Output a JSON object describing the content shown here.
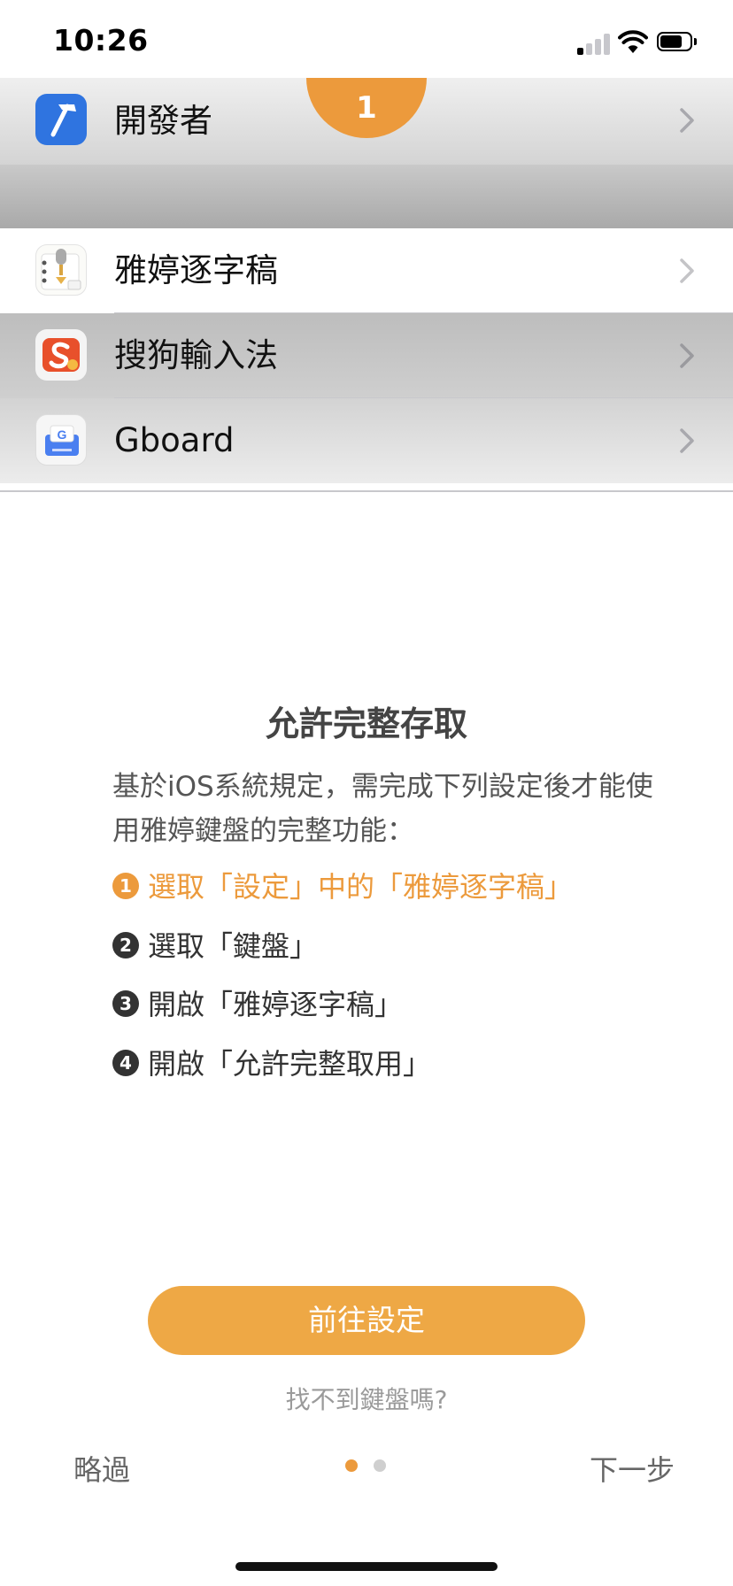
{
  "status_bar": {
    "time": "10:26",
    "signal_bars": 1,
    "wifi_icon": "wifi-icon",
    "battery_level": 0.6
  },
  "settings_preview": {
    "badge": "1",
    "rows": [
      {
        "label": "開發者",
        "icon": "hammer-icon",
        "icon_color": "#2f74e0"
      },
      {
        "label": "雅婷逐字稿",
        "icon": "notepad-microphone-icon"
      },
      {
        "label": "搜狗輸入法",
        "icon": "sogou-icon",
        "icon_color": "#e8502b"
      },
      {
        "label": "Gboard",
        "icon": "gboard-icon",
        "icon_color": "#4a7ff0"
      }
    ]
  },
  "title": "允許完整存取",
  "description": "基於iOS系統規定，需完成下列設定後才能使用雅婷鍵盤的完整功能：",
  "steps": [
    {
      "num": "1",
      "text": "選取「設定」中的「雅婷逐字稿」",
      "active": true
    },
    {
      "num": "2",
      "text": "選取「鍵盤」",
      "active": false
    },
    {
      "num": "3",
      "text": "開啟「雅婷逐字稿」",
      "active": false
    },
    {
      "num": "4",
      "text": "開啟「允許完整取用」",
      "active": false
    }
  ],
  "go_settings_button": "前往設定",
  "help_link": "找不到鍵盤嗎?",
  "skip_label": "略過",
  "next_label": "下一步",
  "pagination": {
    "current": 1,
    "total": 2
  },
  "colors": {
    "accent": "#ec9a3c",
    "button": "#eea845"
  }
}
